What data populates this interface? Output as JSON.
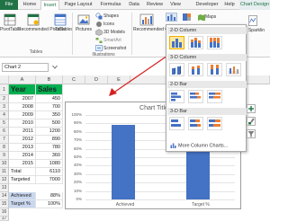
{
  "tabs": [
    {
      "label": "File",
      "active": false
    },
    {
      "label": "Home",
      "active": false
    },
    {
      "label": "Insert",
      "active": true
    },
    {
      "label": "Page Layout",
      "active": false
    },
    {
      "label": "Formulas",
      "active": false
    },
    {
      "label": "Data",
      "active": false
    },
    {
      "label": "Review",
      "active": false
    },
    {
      "label": "View",
      "active": false
    },
    {
      "label": "Developer",
      "active": false
    },
    {
      "label": "Help",
      "active": false
    },
    {
      "label": "Chart Design",
      "active": false
    }
  ],
  "ribbon": {
    "pivot": "PivotTable",
    "recommended_pivot": "Recommended PivotTables",
    "table": "Table",
    "tables_group": "Tables",
    "pictures": "Pictures",
    "shapes": "Shapes",
    "icons": "Icons",
    "models": "3D Models",
    "smartart": "SmartArt",
    "screenshot": "Screenshot",
    "illustrations_group": "Illustrations",
    "recommended_charts": "Recommended Charts",
    "maps": "Maps",
    "sparkline": "Sparklin"
  },
  "name_box": "Chart 2",
  "columns": [
    "A",
    "B",
    "C",
    "D",
    "E"
  ],
  "rows": [
    "1",
    "2",
    "3",
    "4",
    "5",
    "6",
    "7",
    "8",
    "9",
    "10",
    "11",
    "12",
    "13",
    "14",
    "15",
    "16",
    "17"
  ],
  "table": {
    "header": [
      "Year",
      "Sales"
    ],
    "rows": [
      [
        "2007",
        "450"
      ],
      [
        "2008",
        "700"
      ],
      [
        "2009",
        "350"
      ],
      [
        "2010",
        "500"
      ],
      [
        "2011",
        "1200"
      ],
      [
        "2012",
        "890"
      ],
      [
        "2013",
        "780"
      ],
      [
        "2014",
        "360"
      ],
      [
        "2015",
        "1080"
      ]
    ],
    "total_label": "Total",
    "total_value": "6110",
    "targeted_label": "Targeted",
    "targeted_value": "7000",
    "achieved_label": "Achieved",
    "achieved_value": "88%",
    "target_pct_label": "Target %",
    "target_pct_value": "100%"
  },
  "colors": {
    "excel_green": "#217346",
    "header_fill": "#00b050",
    "pct_fill": "#c9d7f0",
    "bar": "#4472c4"
  },
  "dropdown": {
    "sections": [
      "2-D Column",
      "3-D Column",
      "2-D Bar",
      "3-D Bar"
    ],
    "more": "More Column Charts..."
  },
  "chart_data": {
    "type": "bar",
    "title": "Chart Title",
    "categories": [
      "Achieved",
      "Target %"
    ],
    "values": [
      88,
      100
    ],
    "ylim": [
      0,
      100
    ],
    "yticks": [
      "100%",
      "90%",
      "80%",
      "70%",
      "60%",
      "50%",
      "40%",
      "30%",
      "20%",
      "10%",
      "0%"
    ],
    "grid": true
  }
}
